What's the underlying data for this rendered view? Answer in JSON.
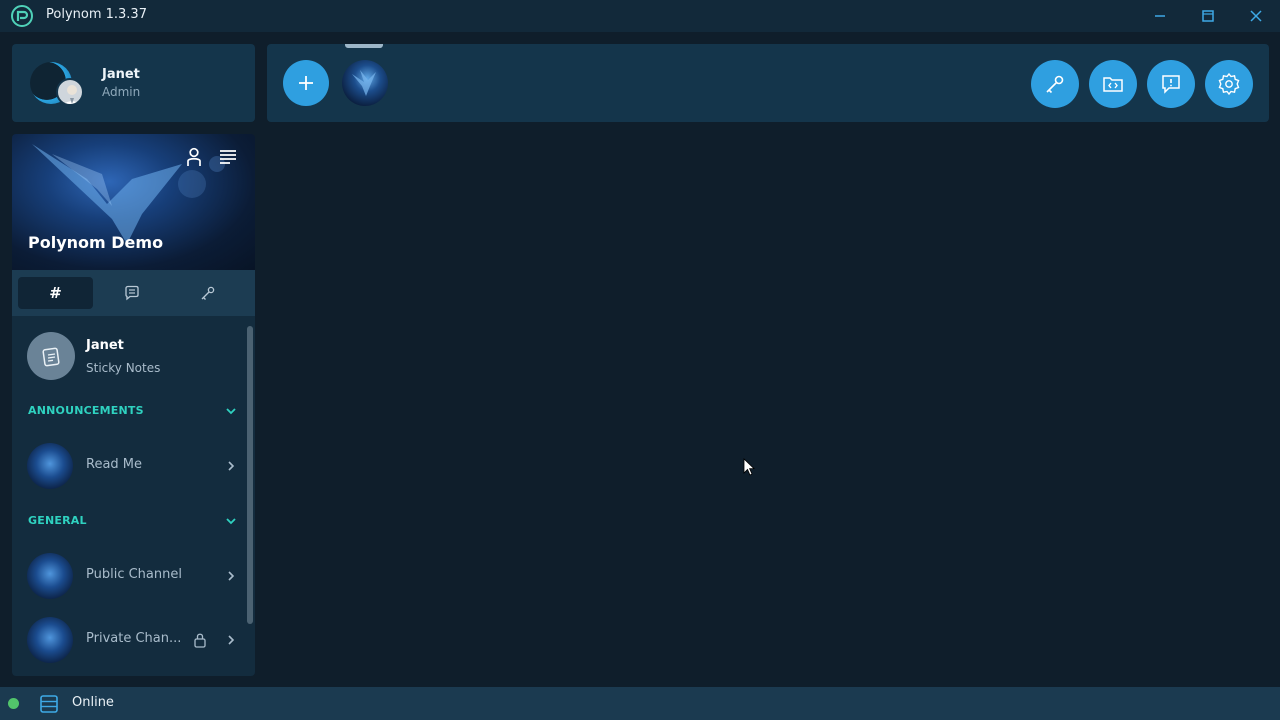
{
  "window": {
    "title": "Polynom 1.3.37"
  },
  "user": {
    "name": "Janet",
    "role": "Admin"
  },
  "server": {
    "name": "Polynom Demo"
  },
  "sidebar": {
    "sticky_notes": {
      "title": "Janet",
      "subtitle": "Sticky Notes"
    },
    "sections": [
      {
        "name": "ANNOUNCEMENTS",
        "channels": [
          {
            "name": "Read Me",
            "locked": false
          }
        ]
      },
      {
        "name": "GENERAL",
        "channels": [
          {
            "name": "Public Channel",
            "locked": false
          },
          {
            "name": "Private Chan...",
            "locked": true
          }
        ]
      }
    ]
  },
  "tabs": [
    {
      "icon": "hash-icon",
      "label": "#",
      "active": true
    },
    {
      "icon": "chat-icon",
      "active": false
    },
    {
      "icon": "key-icon",
      "active": false
    }
  ],
  "toolbar": {
    "icons": [
      "key-icon",
      "code-folder-icon",
      "feedback-icon",
      "settings-icon"
    ]
  },
  "status": {
    "text": "Online",
    "color": "#52c46b"
  },
  "colors": {
    "accent": "#2f9fe0",
    "section": "#2fd2c0",
    "panel": "#14354b",
    "background": "#0f1e2b"
  }
}
